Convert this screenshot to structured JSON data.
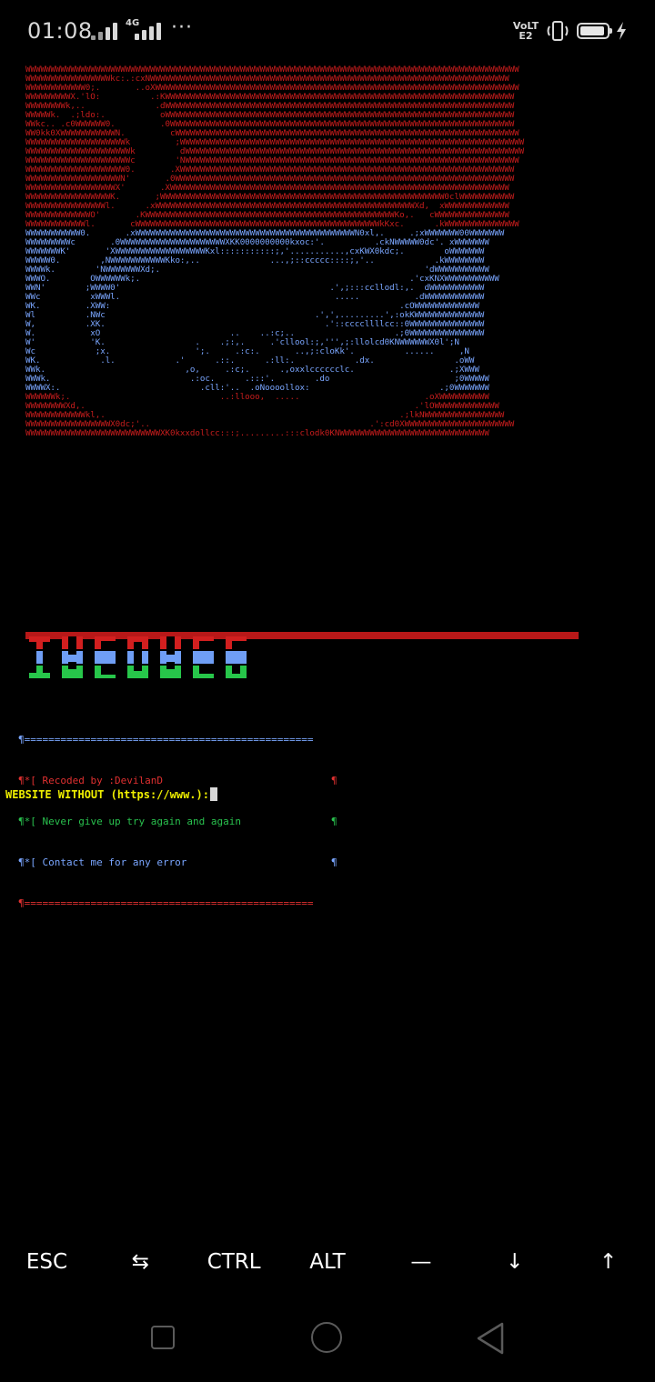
{
  "status_bar": {
    "time": "01:08",
    "network_type": "4G",
    "volte_label": "VoLTE2",
    "battery_level": 0.95,
    "more_label": "···"
  },
  "terminal": {
    "art_lines": [
      {
        "color": "red",
        "text": "WWWWWWWWWWWWWWWWWWWWWWWWWWWWWWWWWWWWWWWWWWWWWWWWWWWWWWWWWWWWWWWWWWWWWWWWWWWWWWWWWWWWWWWWWWWWWWWWWWW"
      },
      {
        "color": "red",
        "text": "WWWWWWWWWWWWWWWWWkc:.:cxNWWWWWWWWWWWWWWWWWWWWWWWWWWWWWWWWWWWWWWWWWWWWWWWWWWWWWWWWWWWWWWWWWWWWWWWW"
      },
      {
        "color": "red",
        "text": "WWWWWWWWWWWW0;.       ..oXWWWWWWWWWWWWWWWWWWWWWWWWWWWWWWWWWWWWWWWWWWWWWWWWWWWWWWWWWWWWWWWWWWWWWWWWW"
      },
      {
        "color": "red",
        "text": "WWWWWWWWWX.'lO:          .:KWWWWWWWWWWWWWWWWWWWWWWWWWWWWWWWWWWWWWWWWWWWWWWWWWWWWWWWWWWWWWWWWWWWWWW"
      },
      {
        "color": "red",
        "text": "WWWWWWWWk,..              .dWWWWWWWWWWWWWWWWWWWWWWWWWWWWWWWWWWWWWWWWWWWWWWWWWWWWWWWWWWWWWWWWWWWWWW"
      },
      {
        "color": "red",
        "text": "WWWWWk.  .;ldo:.           oWWWWWWWWWWWWWWWWWWWWWWWWWWWWWWWWWWWWWWWWWWWWWWWWWWWWWWWWWWWWWWWWWWWWWW"
      },
      {
        "color": "red",
        "text": "WWkc.. .c0WWWWWW0.         .0WWWWWWWWWWWWWWWWWWWWWWWWWWWWWWWWWWWWWWWWWWWWWWWWWWWWWWWWWWWWWWWWWWWWW"
      },
      {
        "color": "red",
        "text": "WW0kk0XWWWWWWWWWWWN.         cWWWWWWWWWWWWWWWWWWWWWWWWWWWWWWWWWWWWWWWWWWWWWWWWWWWWWWWWWWWWWWWWWWWWW"
      },
      {
        "color": "red",
        "text": "WWWWWWWWWWWWWWWWWWWWk         ;WWWWWWWWWWWWWWWWWWWWWWWWWWWWWWWWWWWWWWWWWWWWWWWWWWWWWWWWWWWWWWWWWWWWW"
      },
      {
        "color": "red",
        "text": "WWWWWWWWWWWWWWWWWWWWWk         dWWWWWWWWWWWWWWWWWWWWWWWWWWWWWWWWWWWWWWWWWWWWWWWWWWWWWWWWWWWWWWWWWWWW"
      },
      {
        "color": "red",
        "text": "WWWWWWWWWWWWWWWWWWWWWc        'NWWWWWWWWWWWWWWWWWWWWWWWWWWWWWWWWWWWWWWWWWWWWWWWWWWWWWWWWWWWWWWWWWWW"
      },
      {
        "color": "red",
        "text": "WWWWWWWWWWWWWWWWWWWW0.       .XWWWWWWWWWWWWWWWWWWWWWWWWWWWWWWWWWWWWWWWWWWWWWWWWWWWWWWWWWWWWWWWWWWW"
      },
      {
        "color": "red",
        "text": "WWWWWWWWWWWWWWWWWWWN'       .0WWWWWWWWWWWWWWWWWWWWWWWWWWWWWWWWWWWWWWWWWWWWWWWWWWWWWWWWWWWWWWWWWWWW"
      },
      {
        "color": "red",
        "text": "WWWWWWWWWWWWWWWWWWX'       .XWWWWWWWWWWWWWWWWWWWWWWWWWWWWWWWWWWWWWWWWWWWWWWWWWWWWWWWWWWWWWWWWWWWW"
      },
      {
        "color": "red",
        "text": "WWWWWWWWWWWWWWWWWK.       ;WWWWWWWWWWWWWWWWWWWWWWWWWWWWWWWWWWWWWWWWWWWWWWWWWWWWWWWWW0clWWWWWWWWWWW"
      },
      {
        "color": "red",
        "text": "WWWWWWWWWWWWWWWWl.      .xWWWWWWWWWWWWWWWWWWWWWWWWWWWWWWWWWWWWWWWWWWWWWWWWWWWWXd,  xWWWWWWWWWWWWW"
      },
      {
        "color": "red",
        "text": "WWWWWWWWWWWWWO'       .KWWWWWWWWWWWWWWWWWWWWWWWWWWWWWWWWWWWWWWWWWWWWWWWWWWKo,.   cWWWWWWWWWWWWWWW"
      },
      {
        "color": "red",
        "text": "WWWWWWWWWWWWl.       cWWWWWWWWWWWWWWWWWWWWWWWWWWWWWWWWWWWWWWWWWWWWWWWWWkKxc.      .kWWWWWWWWWWWWWWW"
      },
      {
        "color": "blue",
        "text": "WWWWWWWWWWW0.       .xWWWWWWWWWWWWWWWWWWWWWWWWWWWWWWWWWWWWWWWWWWWWN0xl,.     .;xWWWWWWW00WWWWWWW"
      },
      {
        "color": "blue",
        "text": "WWWWWWWWWc       .0WWWWWWWWWWWWWWWWWWWWWXKK0000000000kxoc:'.          .ckNWWWWW0dc'. xWWWWWWW"
      },
      {
        "color": "blue",
        "text": "WWWWWWWK'       'XWWWWWWWWWWWWWWWWWWKxl:::::::::::;,'...........,cxKWX0kdc;.        oWWWWWWW"
      },
      {
        "color": "blue",
        "text": "WWWWW0.        ,NWWWWWWWWWWWKko:,..              ...,;::ccccc::::;,'..            .kWWWWWWWW"
      },
      {
        "color": "blue",
        "text": "WWWWk.        'NWWWWWWWXd;.                                                     'dWWWWWWWWWWW"
      },
      {
        "color": "blue",
        "text": "WWWO.        OWWWWWWk;.                                                      .'cxKNXWWWWWWWWWWW"
      },
      {
        "color": "blue",
        "text": "WWN'        ;WWWW0'                                          .',;:::ccllodl:,.  dWWWWWWWWWWW"
      },
      {
        "color": "blue",
        "text": "WWc          xWWWl.                                           .....           .dWWWWWWWWWWWW"
      },
      {
        "color": "blue",
        "text": "WK.         .XWW:                                                          .cOWWWWWWWWWWWWW"
      },
      {
        "color": "blue",
        "text": "Wl          .NWc                                          .',',.........',:okKWWWWWWWWWWWWWW"
      },
      {
        "color": "blue",
        "text": "W,          .XK.                                            .'::ccccllllcc::0WWWWWWWWWWWWWWW"
      },
      {
        "color": "blue",
        "text": "W.           xO                          ..    ..:c;..                    .;0WWWWWWWWWWWWWWW"
      },
      {
        "color": "blue",
        "text": "W'           'K.                  .    .;:,.     .'cllool:;,''',;:llolcd0KNWWWWWWX0l';N"
      },
      {
        "color": "blue",
        "text": "Wc            ;x.                 ';.     .:c:.       ..,;:cloKk'.          ......     ,N"
      },
      {
        "color": "blue",
        "text": "WK.            .l.            .'      .::.      .:ll:.            .dx.                .oWW"
      },
      {
        "color": "blue",
        "text": "WWk.                            ,o,     .:c;.      .,oxxlcccccclc.                   .;XWWW"
      },
      {
        "color": "blue",
        "text": "WWWk.                            .:oc.      .:::'.        .do                         ;0WWWWW"
      },
      {
        "color": "blue",
        "text": "WWWWX:.                            .cll:'..  .oNoooollox:                          .;0WWWWWWW"
      },
      {
        "color": "red",
        "text": "WWWWWWk;.                              ..:llooo,  .....                         .oXWWWWWWWWWW"
      },
      {
        "color": "red",
        "text": "WWWWWWWWXd,.                                                                  .'lOWWWWWWWWWWWWW"
      },
      {
        "color": "red",
        "text": "WWWWWWWWWWWWkl,.                                                           .;lkNWWWWWWWWWWWWWWWW"
      },
      {
        "color": "red",
        "text": "WWWWWWWWWWWWWWWWWX0dc;'..                                            .':cd0XWWWWWWWWWWWWWWWWWWWWWW"
      },
      {
        "color": "red",
        "text": "WWWWWWWWWWWWWWWWWWWWWWWWWWWXK0kxxdollcc:::;.........:::clodk0KNWWWWWWWWWWWWWWWWWWWWWWWWWWWWWW"
      }
    ],
    "banner_top_border": "¶================================================",
    "banner_lines": [
      {
        "color": "red",
        "text": "¶*[ Recoded by :DevilanD"
      },
      {
        "color": "green",
        "text": "¶*[ Never give up try again and again"
      },
      {
        "color": "blue",
        "text": "¶*[ Contact me for any error"
      }
    ],
    "banner_right_mark": "¶",
    "banner_bottom_border": "¶================================================",
    "prompt": "WEBSITE WITHOUT (https://www.):"
  },
  "extra_keys": [
    "ESC",
    "⇆",
    "CTRL",
    "ALT",
    "—",
    "↓",
    "↑"
  ],
  "colors": {
    "background": "#000000",
    "art_red": "#c81d1d",
    "art_blue": "#7aa6ff",
    "prompt_yellow": "#f0f000",
    "banner_green": "#29c14e"
  }
}
